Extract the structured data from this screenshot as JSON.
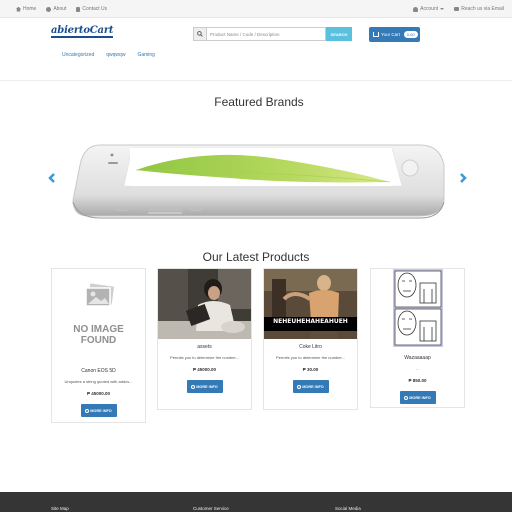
{
  "topbar": {
    "home": "Home",
    "about": "About",
    "contact": "Contact Us",
    "account": "Account",
    "email": "Reach us via Email"
  },
  "header": {
    "logo": "abiertoCart",
    "search_placeholder": "Product Name / Code / Description",
    "search_button": "SEARCH",
    "cart_label": "Your Cart",
    "cart_count": "0.00"
  },
  "categories": [
    "Uncategorized",
    "qwqwqw",
    "Gaming"
  ],
  "featured": {
    "title": "Featured Brands"
  },
  "latest": {
    "title": "Our Latest Products",
    "more_label": "MORE INFO",
    "products": [
      {
        "name": "Canon EOS 5D",
        "desc": "Unquotes a string quoted with addcs...",
        "price": "₱ 45000.00",
        "image": "no-image",
        "no_image_text_1": "NO IMAGE",
        "no_image_text_2": "FOUND"
      },
      {
        "name": "assets",
        "desc": "Permits you to determine the number...",
        "price": "₱ 45000.00",
        "image": "photo-person-laptop"
      },
      {
        "name": "Coke Litro",
        "desc": "Permits you to determine the number...",
        "price": "₱ 30.00",
        "image": "meme-photo",
        "meme_text": "NEHEUHEHAHEAHUEH"
      },
      {
        "name": "Wazaaaaap",
        "desc": "...",
        "price": "₱ 850.00",
        "image": "rage-comic"
      }
    ]
  },
  "footer": {
    "col1": "Site Map",
    "col2": "Customer Service",
    "col3": "Social Media"
  },
  "colors": {
    "primary": "#337ab7",
    "info": "#5bc0de",
    "footer": "#353535"
  }
}
